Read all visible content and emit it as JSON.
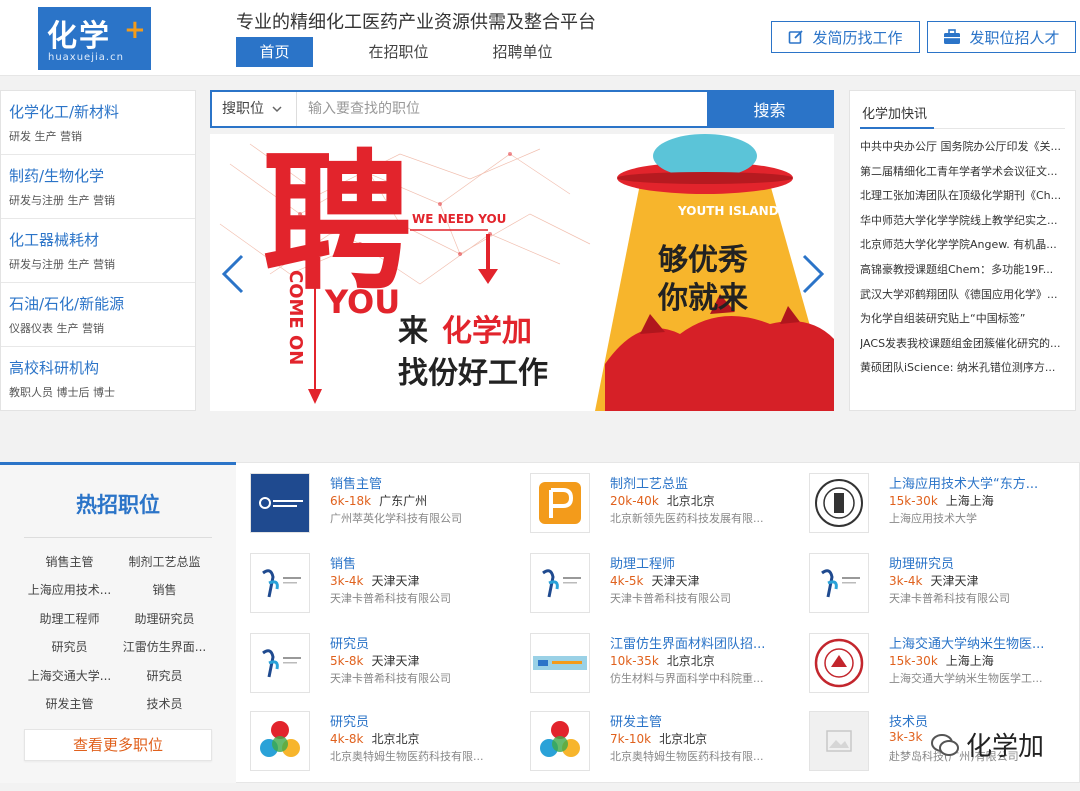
{
  "header": {
    "logo_text": "化学",
    "logo_plus": "+",
    "logo_domain": "huaxuejia.cn",
    "slogan": "专业的精细化工医药产业资源供需及整合平台",
    "nav": [
      {
        "label": "首页"
      },
      {
        "label": "在招职位"
      },
      {
        "label": "招聘单位"
      }
    ],
    "buttons": {
      "resume": "发简历找工作",
      "post_job": "发职位招人才"
    }
  },
  "categories": [
    {
      "title": "化学化工/新材料",
      "sub": "研发 生产 营销"
    },
    {
      "title": "制药/生物化学",
      "sub": "研发与注册 生产 营销"
    },
    {
      "title": "化工器械耗材",
      "sub": "研发与注册 生产 营销"
    },
    {
      "title": "石油/石化/新能源",
      "sub": "仪器仪表 生产 营销"
    },
    {
      "title": "高校科研机构",
      "sub": "教职人员 博士后 博士"
    }
  ],
  "search": {
    "select_label": "搜职位",
    "placeholder": "输入要查找的职位",
    "button": "搜索"
  },
  "banner": {
    "big_char": "聘",
    "we_need_you": "WE NEED YOU",
    "you": "YOU",
    "come_on": "COME ON",
    "line1_black": "来",
    "line1_red": "化学加",
    "line2": "找份好工作",
    "island": "YOUTH ISLAND",
    "excellent_1": "够优秀",
    "excellent_2": "你就来",
    "colors": {
      "red": "#e2242c",
      "yellow": "#f7b52c"
    }
  },
  "news": {
    "title": "化学加快讯",
    "items": [
      "中共中央办公厅 国务院办公厅印发《关...",
      "第二届精细化工青年学者学术会议征文...",
      "北理工张加涛团队在顶级化学期刊《Ch...",
      "华中师范大学化学学院线上教学纪实之...",
      "北京师范大学化学学院Angew. 有机晶...",
      "高锦豪教授课题组Chem：多功能19F...",
      "武汉大学邓鹤翔团队《德国应用化学》...",
      "为化学自组装研究贴上“中国标签”",
      "JACS发表我校课题组金团簇催化研究的...",
      "黄硕团队iScience: 纳米孔错位测序方..."
    ]
  },
  "hot": {
    "title": "热招职位",
    "items": [
      "销售主管",
      "制剂工艺总监",
      "上海应用技术...",
      "销售",
      "助理工程师",
      "助理研究员",
      "研究员",
      "江雷仿生界面...",
      "上海交通大学...",
      "研究员",
      "研发主管",
      "技术员"
    ],
    "more": "查看更多职位"
  },
  "jobs": [
    {
      "title": "销售主管",
      "salary": "6k-18k",
      "city": "广东广州",
      "company": "广州萃英化学科技有限公司",
      "logo": "cuiying-logo"
    },
    {
      "title": "制剂工艺总监",
      "salary": "20k-40k",
      "city": "北京北京",
      "company": "北京新领先医药科技发展有限...",
      "logo": "leadingpharm-logo"
    },
    {
      "title": "上海应用技术大学“东方...",
      "salary": "15k-30k",
      "city": "上海上海",
      "company": "上海应用技术大学",
      "logo": "sit-logo"
    },
    {
      "title": "销售",
      "salary": "3k-4k",
      "city": "天津天津",
      "company": "天津卡普希科技有限公司",
      "logo": "kapuxi-logo"
    },
    {
      "title": "助理工程师",
      "salary": "4k-5k",
      "city": "天津天津",
      "company": "天津卡普希科技有限公司",
      "logo": "kapuxi-logo"
    },
    {
      "title": "助理研究员",
      "salary": "3k-4k",
      "city": "天津天津",
      "company": "天津卡普希科技有限公司",
      "logo": "kapuxi-logo"
    },
    {
      "title": "研究员",
      "salary": "5k-8k",
      "city": "天津天津",
      "company": "天津卡普希科技有限公司",
      "logo": "kapuxi-logo"
    },
    {
      "title": "江雷仿生界面材料团队招...",
      "salary": "10k-35k",
      "city": "北京北京",
      "company": "仿生材料与界面科学中科院重...",
      "logo": "jianglei-logo"
    },
    {
      "title": "上海交通大学纳米生物医...",
      "salary": "15k-30k",
      "city": "上海上海",
      "company": "上海交通大学纳米生物医学工...",
      "logo": "sjtu-logo"
    },
    {
      "title": "研究员",
      "salary": "4k-8k",
      "city": "北京北京",
      "company": "北京奥特姆生物医药科技有限...",
      "logo": "atm-logo"
    },
    {
      "title": "研发主管",
      "salary": "7k-10k",
      "city": "北京北京",
      "company": "北京奥特姆生物医药科技有限...",
      "logo": "atm-logo"
    },
    {
      "title": "技术员",
      "salary": "3k-3k",
      "city": "",
      "company": "赴梦岛科技(广州)有限公司",
      "logo": "placeholder-logo"
    }
  ],
  "watermark": "化学加"
}
